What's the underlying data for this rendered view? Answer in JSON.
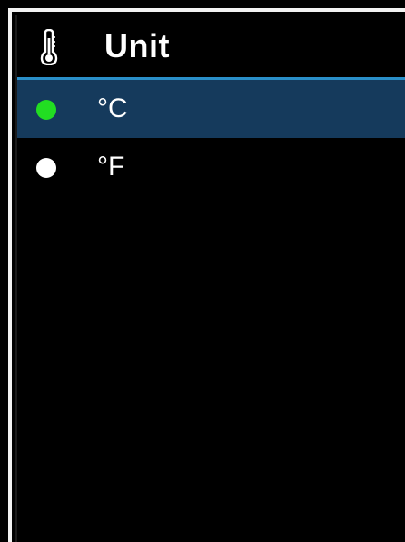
{
  "header": {
    "icon": "thermometer-icon",
    "title": "Unit"
  },
  "options": [
    {
      "label": "°C",
      "selected": true,
      "dot_color": "#22dd22"
    },
    {
      "label": "°F",
      "selected": false,
      "dot_color": "#ffffff"
    }
  ],
  "colors": {
    "background": "#000000",
    "selected_row": "#153a5c",
    "accent_rule": "#2a8fc9",
    "border": "#f2f2f2"
  }
}
